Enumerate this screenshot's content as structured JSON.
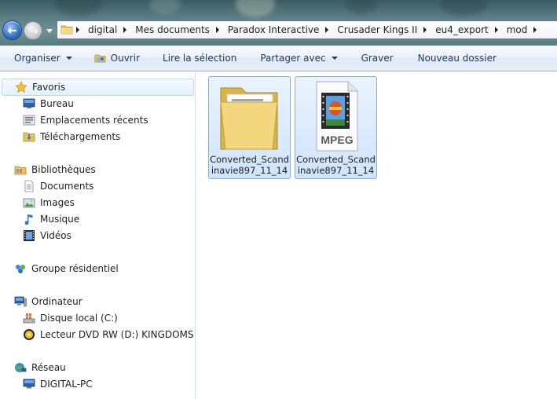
{
  "address": {
    "crumbs": [
      "digital",
      "Mes documents",
      "Paradox Interactive",
      "Crusader Kings II",
      "eu4_export",
      "mod"
    ]
  },
  "toolbar": {
    "organize": "Organiser",
    "open": "Ouvrir",
    "play_selection": "Lire la sélection",
    "share": "Partager avec",
    "burn": "Graver",
    "new_folder": "Nouveau dossier"
  },
  "nav": {
    "favorites": "Favoris",
    "desktop": "Bureau",
    "recent": "Emplacements récents",
    "downloads": "Téléchargements",
    "libraries": "Bibliothèques",
    "documents": "Documents",
    "images": "Images",
    "music": "Musique",
    "videos": "Vidéos",
    "homegroup": "Groupe résidentiel",
    "computer": "Ordinateur",
    "local_disk": "Disque local (C:)",
    "dvd": "Lecteur DVD RW (D:) KINGDOMS",
    "network": "Réseau",
    "network_pc": "DIGITAL-PC"
  },
  "files": [
    {
      "name": "Converted_Scandinavie897_11_14",
      "type": "folder"
    },
    {
      "name": "Converted_Scandinavie897_11_14",
      "type": "mpeg",
      "badge": "MPEG"
    }
  ],
  "colors": {
    "accent": "#1e395b",
    "selection": "#cfe4fb"
  }
}
